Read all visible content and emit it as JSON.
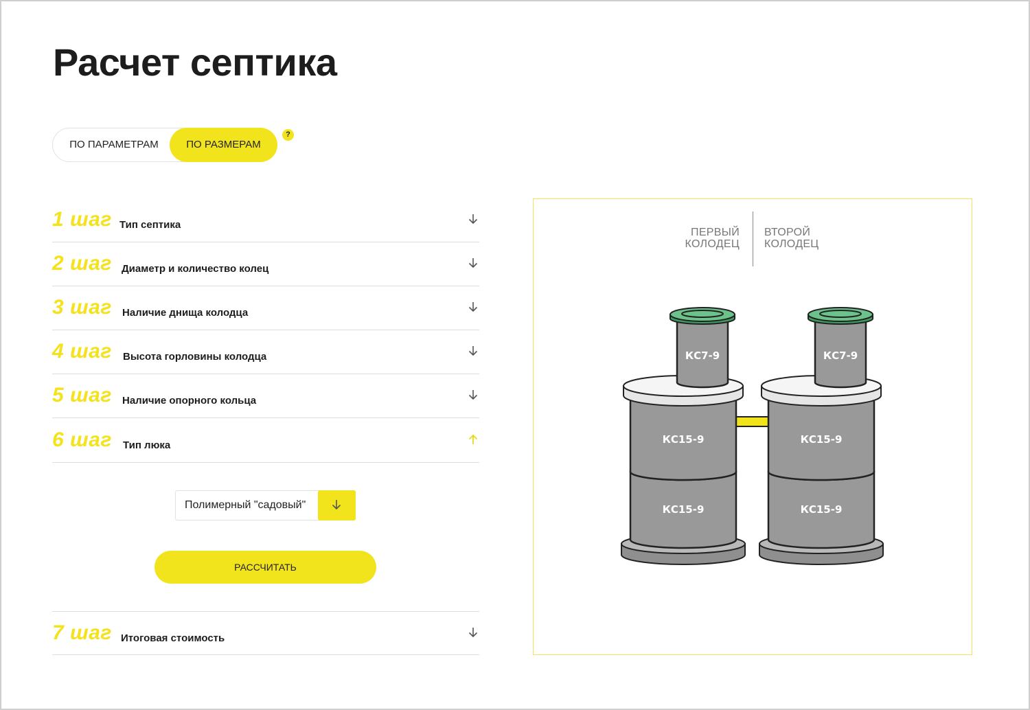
{
  "page_title": "Расчет септика",
  "mode_switch": {
    "by_params": "ПО ПАРАМЕТРАМ",
    "by_size": "ПО РАЗМЕРАМ",
    "help": "?"
  },
  "steps": [
    {
      "num": "1 шаг",
      "title": "Тип септика",
      "expanded": false
    },
    {
      "num": "2 шаг",
      "title": "Диаметр и количество колец",
      "expanded": false
    },
    {
      "num": "3 шаг",
      "title": "Наличие днища колодца",
      "expanded": false
    },
    {
      "num": "4 шаг",
      "title": "Высота горловины колодца",
      "expanded": false
    },
    {
      "num": "5 шаг",
      "title": "Наличие опорного кольца",
      "expanded": false
    },
    {
      "num": "6 шаг",
      "title": "Тип люка",
      "expanded": true
    },
    {
      "num": "7 шаг",
      "title": "Итоговая стоимость",
      "expanded": false
    }
  ],
  "hatch_select": {
    "value": "Полимерный \"садовый\""
  },
  "calculate_button": "РАССЧИТАТЬ",
  "diagram": {
    "first_well_label": [
      "ПЕРВЫЙ",
      "КОЛОДЕЦ"
    ],
    "second_well_label": [
      "ВТОРОЙ",
      "КОЛОДЕЦ"
    ],
    "wells": [
      {
        "neck": "КС7-9",
        "rings": [
          "КС15-9",
          "КС15-9"
        ]
      },
      {
        "neck": "КС7-9",
        "rings": [
          "КС15-9",
          "КС15-9"
        ]
      }
    ]
  },
  "colors": {
    "accent": "#f2e41c",
    "ring_gray": "#999999",
    "hatch_green": "#5cb37a",
    "pipe_yellow": "#f2e41c"
  }
}
